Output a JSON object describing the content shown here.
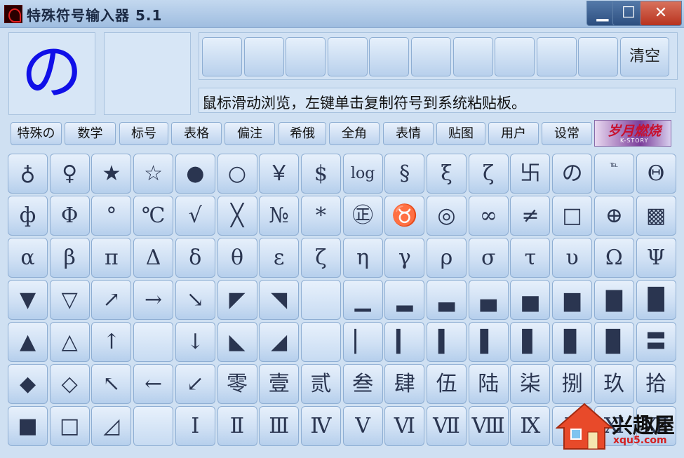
{
  "window": {
    "title": "特殊符号输入器 5.1",
    "minimize": "▁",
    "maximize": "☐",
    "close": "✕"
  },
  "preview": {
    "glyph": "の",
    "glyph_color": "#1010e8"
  },
  "clear_label": "清空",
  "status_text": "鼠标滑动浏览，左键单击复制符号到系统粘贴板。",
  "tabs": [
    "特殊の",
    "数学",
    "标号",
    "表格",
    "偏注",
    "希俄",
    "全角",
    "表情",
    "贴图",
    "用户",
    "设常"
  ],
  "banner": {
    "title": "岁月燃烧",
    "subtitle": "K-STORY"
  },
  "watermark": {
    "text": "兴趣屋",
    "url": "xqu5.com"
  },
  "rows": [
    [
      "♁",
      "♀",
      "★",
      "☆",
      "●",
      "○",
      "￥",
      "$",
      "log",
      "§",
      "ξ",
      "ζ",
      "卐",
      "の",
      "℡",
      "Θ"
    ],
    [
      "ф",
      "Φ",
      "°",
      "℃",
      "√",
      "╳",
      "№",
      "*",
      "㊣",
      "♉",
      "◎",
      "∞",
      "≠",
      "□",
      "⊕",
      "▩"
    ],
    [
      "α",
      "β",
      "π",
      "Δ",
      "δ",
      "θ",
      "ε",
      "ζ",
      "η",
      "γ",
      "ρ",
      "σ",
      "τ",
      "υ",
      "Ω",
      "Ψ"
    ],
    [
      "▼",
      "▽",
      "↗",
      "→",
      "↘",
      "◤",
      "◥",
      "",
      "▁",
      "▂",
      "▃",
      "▄",
      "▅",
      "▆",
      "▇",
      "█"
    ],
    [
      "▲",
      "△",
      "↑",
      "",
      "↓",
      "◣",
      "◢",
      "",
      "▏",
      "▎",
      "▍",
      "▌",
      "▋",
      "▊",
      "▉",
      "〓"
    ],
    [
      "◆",
      "◇",
      "↖",
      "←",
      "↙",
      "零",
      "壹",
      "贰",
      "叁",
      "肆",
      "伍",
      "陆",
      "柒",
      "捌",
      "玖",
      "拾"
    ],
    [
      "■",
      "□",
      "◿",
      "",
      "Ⅰ",
      "Ⅱ",
      "Ⅲ",
      "Ⅳ",
      "Ⅴ",
      "Ⅵ",
      "Ⅶ",
      "Ⅷ",
      "Ⅸ",
      "Ⅹ",
      "Ⅺ",
      "Ⅻ"
    ]
  ]
}
